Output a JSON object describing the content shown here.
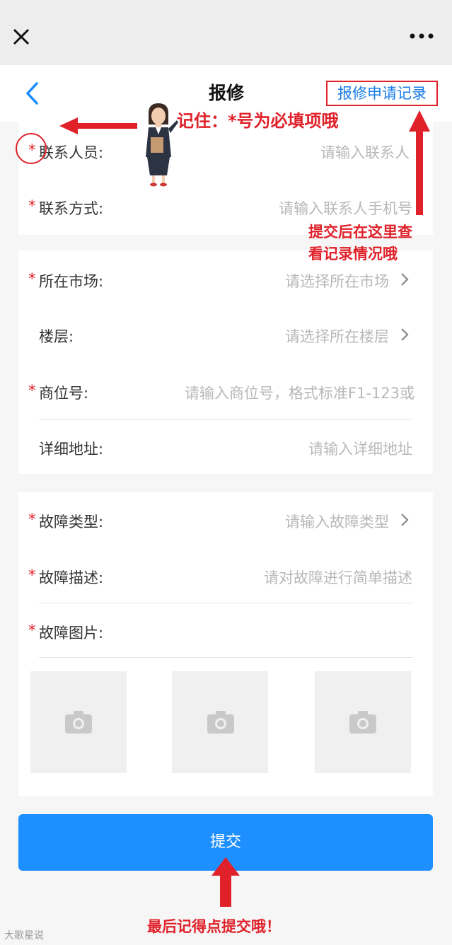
{
  "nav": {
    "title": "报修",
    "record_link": "报修申请记录"
  },
  "contact_card": {
    "rows": [
      {
        "required": "*",
        "label": "联系人员:",
        "placeholder": "请输入联系人"
      },
      {
        "required": "*",
        "label": "联系方式:",
        "placeholder": "请输入联系人手机号"
      }
    ]
  },
  "location_card": {
    "rows": [
      {
        "required": "*",
        "label": "所在市场:",
        "placeholder": "请选择所在市场"
      },
      {
        "required": "",
        "label": "楼层:",
        "placeholder": "请选择所在楼层"
      },
      {
        "required": "*",
        "label": "商位号:",
        "placeholder": "请输入商位号，格式标准F1-123或"
      },
      {
        "required": "",
        "label": "详细地址:",
        "placeholder": "请输入详细地址"
      }
    ]
  },
  "fault_card": {
    "rows": [
      {
        "required": "*",
        "label": "故障类型:",
        "placeholder": "请输入故障类型"
      },
      {
        "required": "*",
        "label": "故障描述:",
        "placeholder": "请对故障进行简单描述"
      },
      {
        "required": "*",
        "label": "故障图片:",
        "placeholder": ""
      }
    ]
  },
  "submit_label": "提交",
  "annotations": {
    "remember_required": "记住：*号为必填项哦",
    "check_records": "提交后在这里查\n看记录情况哦",
    "remember_submit": "最后记得点提交哦！"
  },
  "watermark": "大歌星说",
  "colors": {
    "accent_blue": "#1e8fff",
    "link_blue": "#1a7de8",
    "annotation_red": "#e0212a"
  }
}
